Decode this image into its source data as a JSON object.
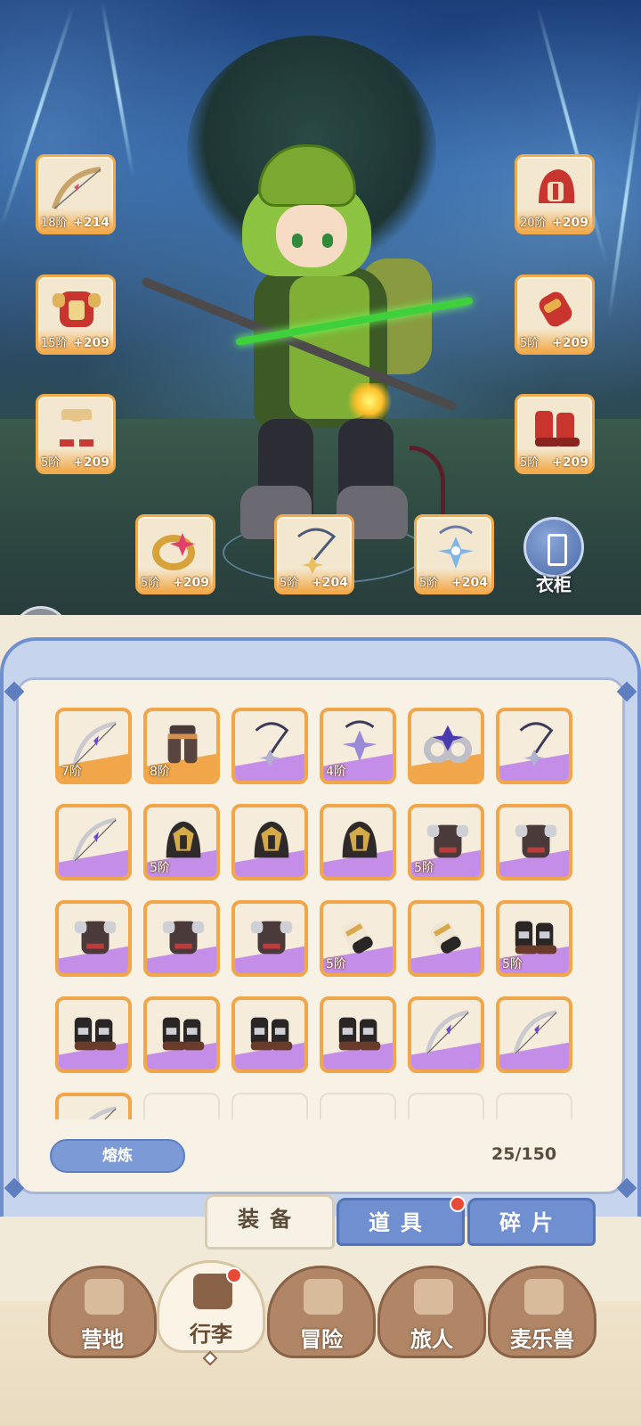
{
  "equipped": {
    "bow": {
      "tier": "18阶",
      "bonus": "+214"
    },
    "armor": {
      "tier": "15阶",
      "bonus": "+209"
    },
    "pants": {
      "tier": "5阶",
      "bonus": "+209"
    },
    "helmet": {
      "tier": "20阶",
      "bonus": "+209"
    },
    "gloves": {
      "tier": "5阶",
      "bonus": "+209"
    },
    "boots": {
      "tier": "5阶",
      "bonus": "+209"
    },
    "ring": {
      "tier": "5阶",
      "bonus": "+209"
    },
    "necklace": {
      "tier": "5阶",
      "bonus": "+204"
    },
    "amulet": {
      "tier": "5阶",
      "bonus": "+204"
    }
  },
  "wardrobe_label": "衣柜",
  "inventory": {
    "items": [
      {
        "icon": "bow-icon",
        "tier": "7阶",
        "rarity": "orange"
      },
      {
        "icon": "pants-icon",
        "tier": "8阶",
        "rarity": "orange"
      },
      {
        "icon": "necklace-icon",
        "tier": "",
        "rarity": "purple"
      },
      {
        "icon": "amulet-icon",
        "tier": "4阶",
        "rarity": "purple"
      },
      {
        "icon": "ring-icon",
        "tier": "",
        "rarity": "orange"
      },
      {
        "icon": "necklace-icon",
        "tier": "",
        "rarity": "purple"
      },
      {
        "icon": "bow-icon",
        "tier": "",
        "rarity": "purple"
      },
      {
        "icon": "helmet-icon",
        "tier": "5阶",
        "rarity": "purple"
      },
      {
        "icon": "helmet-icon",
        "tier": "",
        "rarity": "purple"
      },
      {
        "icon": "helmet-icon",
        "tier": "",
        "rarity": "purple"
      },
      {
        "icon": "armor-icon",
        "tier": "5阶",
        "rarity": "purple"
      },
      {
        "icon": "armor-icon",
        "tier": "",
        "rarity": "purple"
      },
      {
        "icon": "armor-icon",
        "tier": "",
        "rarity": "purple"
      },
      {
        "icon": "armor-icon",
        "tier": "",
        "rarity": "purple"
      },
      {
        "icon": "armor-icon",
        "tier": "",
        "rarity": "purple"
      },
      {
        "icon": "glove-icon",
        "tier": "5阶",
        "rarity": "purple"
      },
      {
        "icon": "glove-icon",
        "tier": "",
        "rarity": "purple"
      },
      {
        "icon": "boots-icon",
        "tier": "5阶",
        "rarity": "purple"
      },
      {
        "icon": "boots-icon",
        "tier": "",
        "rarity": "purple"
      },
      {
        "icon": "boots-icon",
        "tier": "",
        "rarity": "purple"
      },
      {
        "icon": "boots-icon",
        "tier": "",
        "rarity": "purple"
      },
      {
        "icon": "boots-icon",
        "tier": "",
        "rarity": "purple"
      },
      {
        "icon": "bow-icon",
        "tier": "",
        "rarity": "purple"
      },
      {
        "icon": "bow-icon",
        "tier": "",
        "rarity": "purple"
      },
      {
        "icon": "bow-icon",
        "tier": "",
        "rarity": "orange"
      }
    ],
    "smelt_label": "熔炼",
    "capacity": "25/150"
  },
  "subtabs": {
    "equipment": "装备",
    "items": "道具",
    "fragments": "碎片"
  },
  "nav": {
    "camp": "营地",
    "luggage": "行李",
    "adventure": "冒险",
    "traveler": "旅人",
    "mailebeast": "麦乐兽"
  },
  "colors": {
    "orange_rarity": "#f1a64a",
    "purple_rarity": "#c48de8",
    "panel_blue": "#6f8fd0",
    "notification_red": "#e84a3a"
  }
}
